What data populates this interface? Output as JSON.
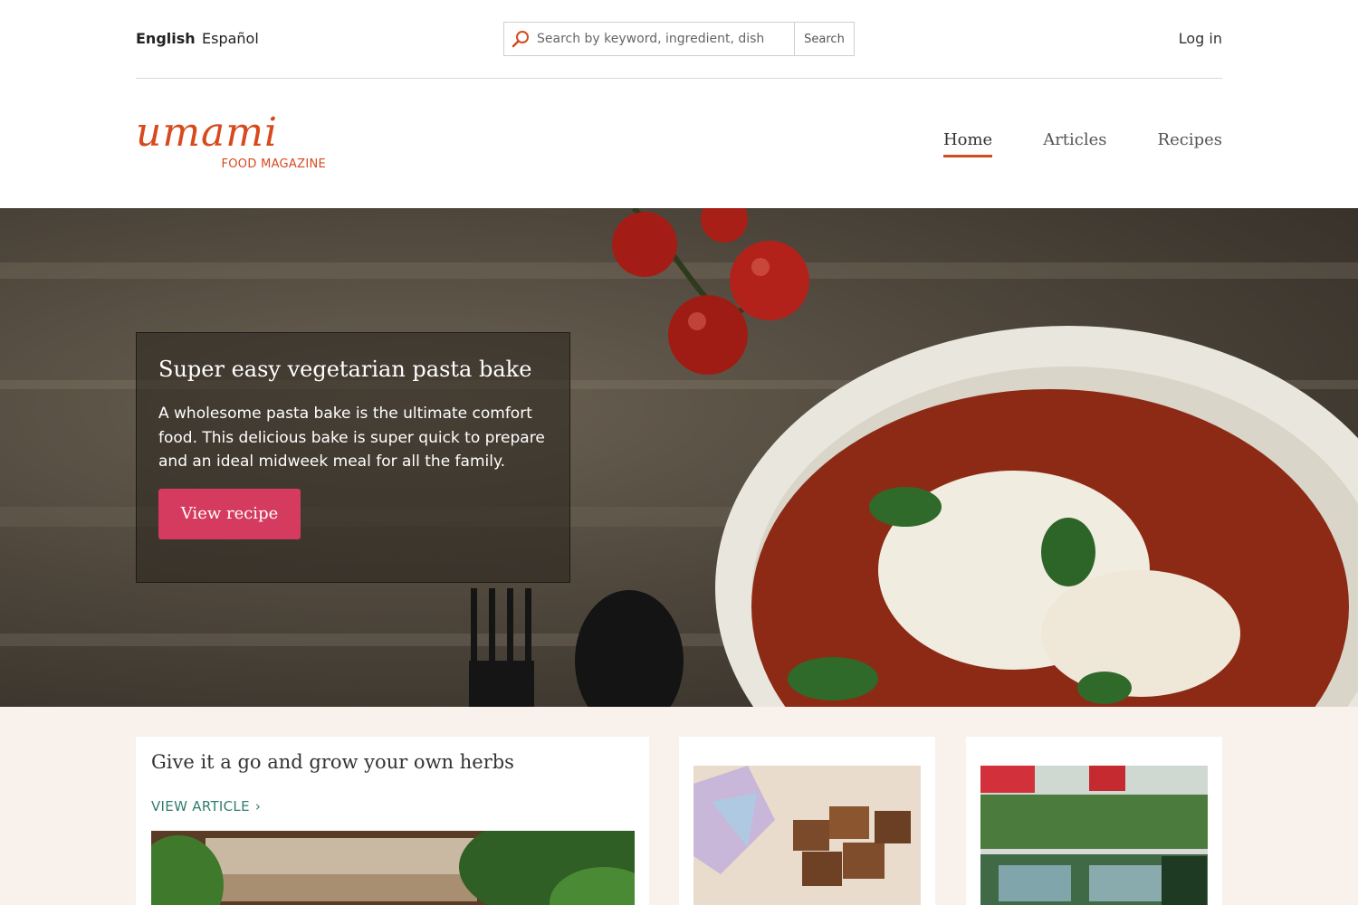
{
  "topbar": {
    "lang_english": "English",
    "lang_spanish": "Español",
    "search_placeholder": "Search by keyword, ingredient, dish",
    "search_button": "Search",
    "login": "Log in"
  },
  "logo": {
    "wordmark": "umami",
    "subtitle": "FOOD MAGAZINE"
  },
  "nav": {
    "items": [
      {
        "label": "Home",
        "active": true
      },
      {
        "label": "Articles",
        "active": false
      },
      {
        "label": "Recipes",
        "active": false
      }
    ]
  },
  "hero": {
    "title": "Super easy vegetarian pasta bake",
    "text": "A wholesome pasta bake is the ultimate comfort food. This delicious bake is super quick to prepare and an ideal midweek meal for all the family.",
    "button": "View recipe"
  },
  "cards": {
    "first": {
      "title": "Give it a go and grow your own herbs",
      "link": "VIEW ARTICLE"
    }
  },
  "colors": {
    "brand": "#d64a1e",
    "cta": "#d53a5f",
    "link": "#2f7d6f",
    "lower_bg": "#f8f1ec"
  },
  "icons": {
    "search": "search-icon",
    "chevron": "chevron-right-icon"
  }
}
